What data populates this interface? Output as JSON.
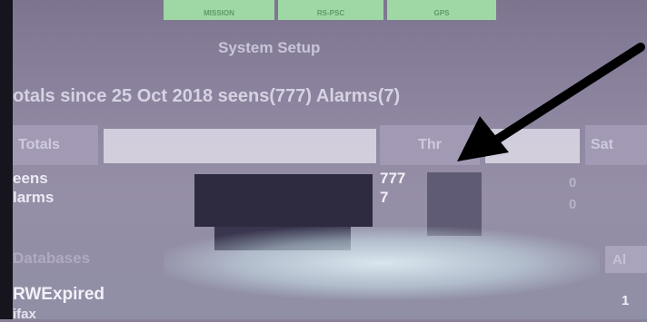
{
  "top_tabs": [
    "MISSION",
    "RS-PSC",
    "GPS"
  ],
  "title": "System Setup",
  "totals_line": "otals since 25 Oct 2018  seens(777) Alarms(7)",
  "table": {
    "headers": {
      "totals": "Totals",
      "thr": "Thr",
      "sat": "Sat"
    },
    "rows": [
      {
        "label": "eens",
        "thr": "777",
        "sat": "0"
      },
      {
        "label": "larms",
        "thr": "7",
        "sat": "0"
      }
    ]
  },
  "databases": {
    "label": "Databases",
    "col": "Al"
  },
  "db_rows": [
    {
      "label": "RWExpired",
      "value": "1"
    },
    {
      "label": "ifax",
      "value": ""
    }
  ],
  "colors": {
    "tab_bg": "#9fd8a4",
    "screen_bg": "#8e86a0",
    "arrow": "#000000"
  }
}
